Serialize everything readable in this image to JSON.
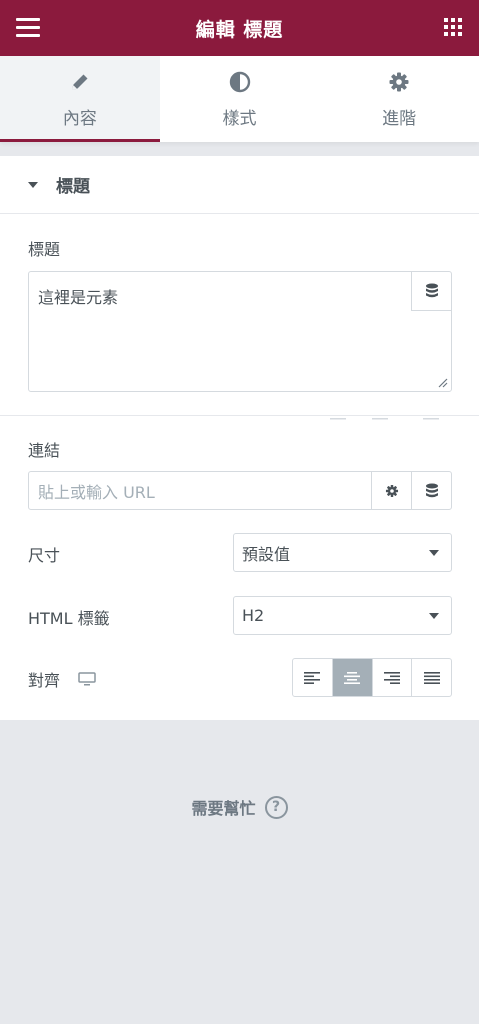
{
  "header": {
    "title": "編輯 標題"
  },
  "tabs": [
    {
      "label": "內容",
      "icon": "pencil-icon",
      "active": true
    },
    {
      "label": "樣式",
      "icon": "contrast-icon",
      "active": false
    },
    {
      "label": "進階",
      "icon": "gear-icon",
      "active": false
    }
  ],
  "section": {
    "title": "標題"
  },
  "title_control": {
    "label": "標題",
    "value": "這裡是元素"
  },
  "link_control": {
    "label": "連結",
    "placeholder": "貼上或輸入 URL"
  },
  "size_control": {
    "label": "尺寸",
    "value": "預設值"
  },
  "html_tag_control": {
    "label": "HTML 標籤",
    "value": "H2"
  },
  "align_control": {
    "label": "對齊",
    "options": [
      "left",
      "center",
      "right",
      "justify"
    ],
    "selected": "center"
  },
  "help": {
    "label": "需要幫忙",
    "icon": "question-icon"
  },
  "colors": {
    "brand": "#8b1a3d",
    "text": "#495157",
    "active_align": "#a4afb7"
  }
}
